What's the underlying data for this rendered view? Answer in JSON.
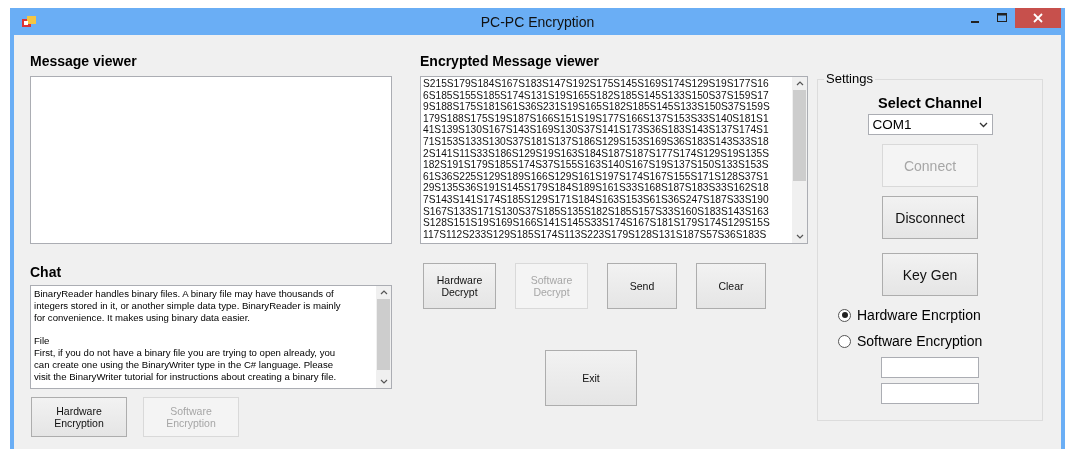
{
  "window": {
    "title": "PC-PC Encryption"
  },
  "message_viewer": {
    "title": "Message viewer"
  },
  "chat": {
    "title": "Chat",
    "text": "BinaryReader handles binary files. A binary file may have thousands of\nintegers stored in it, or another simple data type. BinaryReader is mainly\nfor convenience. It makes using binary data easier.\n\nFile\nFirst, if you do not have a binary file you are trying to open already, you\ncan create one using the BinaryWriter type in the C# language. Please\nvisit the BinaryWriter tutorial for instructions about creating a binary file."
  },
  "left_buttons": [
    {
      "label": "Hardware\nEncryption",
      "disabled": false
    },
    {
      "label": "Software\nEncryption",
      "disabled": true
    }
  ],
  "encrypted_viewer": {
    "title": "Encrypted Message viewer",
    "lines": [
      "S215S179S184S167S183S147S192S175S145S169S174S129S19S177S16",
      "6S185S155S185S174S131S19S165S182S185S145S133S150S37S159S17",
      "9S188S175S181S61S36S231S19S165S182S185S145S133S150S37S159S",
      "179S188S175S19S187S166S151S19S177S166S137S153S33S140S181S1",
      "41S139S130S167S143S169S130S37S141S173S36S183S143S137S174S1",
      "71S153S133S130S37S181S137S186S129S153S169S36S183S143S33S18",
      "2S141S11S33S186S129S19S163S184S187S187S177S174S129S19S135S",
      "182S191S179S185S174S37S155S163S140S167S19S137S150S133S153S",
      "61S36S225S129S189S166S129S161S197S174S167S155S171S128S37S1",
      "29S135S36S191S145S179S184S189S161S33S168S187S183S33S162S18",
      "7S143S141S174S185S129S171S184S163S153S61S36S247S187S33S190",
      "S167S133S171S130S37S185S135S182S185S157S33S160S183S143S163",
      "S128S151S19S169S166S141S145S33S174S167S181S179S174S129S15S",
      "117S112S233S129S185S174S113S223S179S128S131S187S57S36S183S"
    ]
  },
  "middle_buttons": [
    {
      "label": "Hardware\nDecrypt",
      "disabled": false
    },
    {
      "label": "Software\nDecrypt",
      "disabled": true
    },
    {
      "label": "Send",
      "disabled": false
    },
    {
      "label": "Clear",
      "disabled": false
    }
  ],
  "exit_button": {
    "label": "Exit"
  },
  "settings": {
    "title": "Settings",
    "channel_label": "Select Channel",
    "channel_value": "COM1",
    "buttons": [
      {
        "label": "Connect",
        "disabled": true
      },
      {
        "label": "Disconnect",
        "disabled": false
      },
      {
        "label": "Key Gen",
        "disabled": false
      }
    ],
    "radios": [
      {
        "label": "Hardware Encrption",
        "selected": true
      },
      {
        "label": "Software Encryption",
        "selected": false
      }
    ]
  }
}
